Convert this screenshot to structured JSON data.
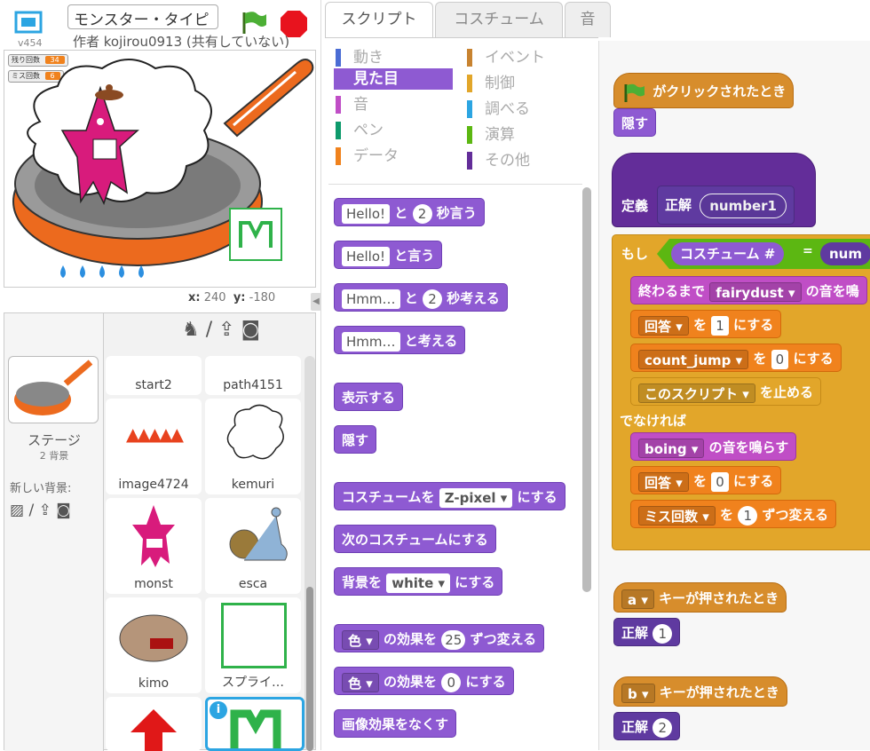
{
  "project": {
    "title": "モンスター・タイピ",
    "author": "作者 kojirou0913 (共有していない)",
    "version": "v454"
  },
  "stage": {
    "var1_label": "残り回数",
    "var1_value": "34",
    "var2_label": "ミス回数",
    "var2_value": "6",
    "coords_x_label": "x:",
    "coords_x": "240",
    "coords_y_label": "y:",
    "coords_y": "-180"
  },
  "sprites": {
    "stage_label": "ステージ",
    "backdrop_count": "2 背景",
    "new_backdrop": "新しい背景:",
    "items": [
      "start2",
      "path4151",
      "image4724",
      "kemuri",
      "monst",
      "esca",
      "kimo",
      "スプライ…"
    ]
  },
  "tabs": [
    "スクリプト",
    "コスチューム",
    "音"
  ],
  "categories": {
    "left": [
      "動き",
      "見た目",
      "音",
      "ペン",
      "データ"
    ],
    "right": [
      "イベント",
      "制御",
      "調べる",
      "演算",
      "その他"
    ],
    "colors": [
      "#4a6cd4",
      "#8e5ad2",
      "#c04ec6",
      "#0e9a6c",
      "#f0821d",
      "#c88330",
      "#e2a62a",
      "#2ca5e2",
      "#5cb712",
      "#632d99"
    ]
  },
  "palette": {
    "say_secs": {
      "hello": "Hello!",
      "to": "と",
      "n": "2",
      "rest": "秒言う"
    },
    "say": {
      "hello": "Hello!",
      "rest": "と言う"
    },
    "think_secs": {
      "hmm": "Hmm…",
      "to": "と",
      "n": "2",
      "rest": "秒考える"
    },
    "think": {
      "hmm": "Hmm…",
      "rest": "と考える"
    },
    "show": "表示する",
    "hide": "隠す",
    "switch_costume": {
      "pre": "コスチュームを",
      "val": "Z-pixel",
      "post": "にする"
    },
    "next_costume": "次のコスチュームにする",
    "switch_backdrop": {
      "pre": "背景を",
      "val": "white",
      "post": "にする"
    },
    "change_effect": {
      "eff": "色",
      "mid": "の効果を",
      "n": "25",
      "post": "ずつ変える"
    },
    "set_effect": {
      "eff": "色",
      "mid": "の効果を",
      "n": "0",
      "post": "にする"
    },
    "clear_effects": "画像効果をなくす"
  },
  "scripts": {
    "flag_hat": "がクリックされたとき",
    "hide": "隠す",
    "define": "定義",
    "proc_name": "正解",
    "param": "number1",
    "if": "もし",
    "cond_left": "コスチューム #",
    "eq": "=",
    "cond_right": "num",
    "play_until": {
      "pre": "終わるまで",
      "val": "fairydust",
      "post": "の音を鳴"
    },
    "set1": {
      "var": "回答",
      "mid": "を",
      "n": "1",
      "post": "にする"
    },
    "set2": {
      "var": "count_jump",
      "mid": "を",
      "n": "0",
      "post": "にする"
    },
    "stop": {
      "val": "このスクリプト",
      "post": "を止める"
    },
    "else": "でなければ",
    "play": {
      "val": "boing",
      "post": "の音を鳴らす"
    },
    "set3": {
      "var": "回答",
      "mid": "を",
      "n": "0",
      "post": "にする"
    },
    "change": {
      "var": "ミス回数",
      "mid": "を",
      "n": "1",
      "post": "ずつ変える"
    },
    "key_a": {
      "key": "a",
      "post": "キーが押されたとき"
    },
    "call_a": {
      "name": "正解",
      "n": "1"
    },
    "key_b": {
      "key": "b",
      "post": "キーが押されたとき"
    },
    "call_b": {
      "name": "正解",
      "n": "2"
    }
  }
}
